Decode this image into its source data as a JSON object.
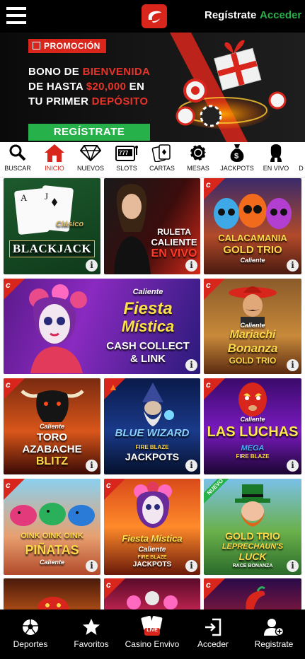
{
  "header": {
    "menu_icon": "hamburger-menu-icon",
    "logo_icon": "caliente-logo-icon",
    "register_label": "Regístrate",
    "login_label": "Acceder",
    "colors": {
      "brand_red": "#d9261c",
      "accent_green": "#27b14a"
    }
  },
  "banner": {
    "tag_label": "PROMOCIÓN",
    "line1_a": "BONO DE ",
    "line1_b": "BIENVENIDA",
    "line2_a": "DE HASTA ",
    "line2_b": "$20,000",
    "line2_c": " EN",
    "line3_a": "TU PRIMER ",
    "line3_b": "DEPÓSITO",
    "cta_label": "REGÍSTRATE"
  },
  "categories": [
    {
      "label": "BUSCAR",
      "icon": "search-icon"
    },
    {
      "label": "INICIO",
      "icon": "home-icon"
    },
    {
      "label": "NUEVOS",
      "icon": "diamond-icon"
    },
    {
      "label": "SLOTS",
      "icon": "slot-machine-icon"
    },
    {
      "label": "CARTAS",
      "icon": "cards-icon"
    },
    {
      "label": "MESAS",
      "icon": "poker-chip-icon"
    },
    {
      "label": "JACKPOTS",
      "icon": "money-bag-icon"
    },
    {
      "label": "EN VIVO",
      "icon": "live-dealer-icon"
    },
    {
      "label": "D",
      "icon": ""
    }
  ],
  "games": [
    {
      "title": "BLACKJACK",
      "subtitle": "Clásico",
      "info": "i"
    },
    {
      "title": "RULETA",
      "title2": "CALIENTE",
      "title3": "EN VIVO",
      "info": "i"
    },
    {
      "title": "CALACAMANIA",
      "subtitle": "GOLD TRIO",
      "brand": "Caliente",
      "info": "i"
    },
    {
      "title": "Fiesta",
      "title2": "Mística",
      "subtitle": "CASH COLLECT",
      "subtitle2": "& LINK",
      "brand": "Caliente",
      "info": "i"
    },
    {
      "title": "Mariachi",
      "title2": "Bonanza",
      "subtitle": "GOLD TRIO",
      "brand": "Caliente",
      "info": "i"
    },
    {
      "title": "TORO",
      "title2": "AZABACHE",
      "title3": "BLITZ",
      "brand": "Caliente",
      "info": "i"
    },
    {
      "title": "BLUE WIZARD",
      "subtitle": "FIRE BLAZE",
      "subtitle2": "JACKPOTS",
      "info": "i"
    },
    {
      "title": "LAS LUCHAS",
      "subtitle": "MEGA",
      "subtitle2": "FIRE BLAZE",
      "brand": "Caliente",
      "info": "i"
    },
    {
      "title": "OINK OINK OINK",
      "title2": "PIÑATAS",
      "brand": "Caliente",
      "info": "i"
    },
    {
      "title": "Fiesta Mística",
      "brand": "Caliente",
      "subtitle": "FIRE BLAZE",
      "subtitle2": "JACKPOTS",
      "info": "i"
    },
    {
      "title": "GOLD TRIO",
      "title2": "LEPRECHAUN'S",
      "title3": "LUCK",
      "subtitle": "RACE BONANZA",
      "badge": "NUEVO",
      "info": "i"
    }
  ],
  "bottom_nav": [
    {
      "label": "Deportes",
      "icon": "soccer-ball-icon"
    },
    {
      "label": "Favoritos",
      "icon": "star-icon"
    },
    {
      "label": "Casino Envivo",
      "icon": "live-casino-icon",
      "badge": "LIVE"
    },
    {
      "label": "Acceder",
      "icon": "login-icon"
    },
    {
      "label": "Registrate",
      "icon": "add-user-icon"
    }
  ]
}
